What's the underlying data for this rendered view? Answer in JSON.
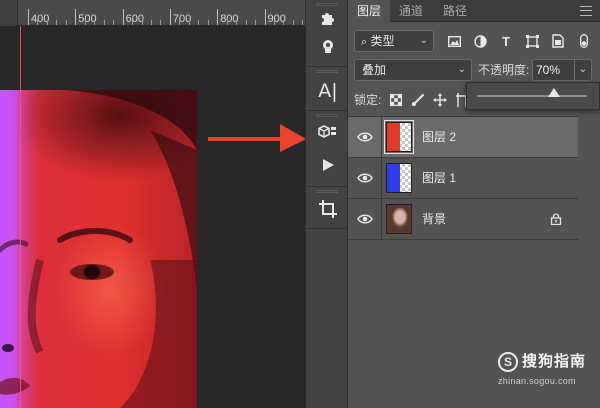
{
  "ruler": {
    "ticks": [
      "400",
      "500",
      "600",
      "700",
      "800",
      "900"
    ]
  },
  "panel": {
    "tabs": [
      {
        "label": "图层",
        "active": true
      },
      {
        "label": "通道",
        "active": false
      },
      {
        "label": "路径",
        "active": false
      }
    ],
    "filter": {
      "label": "类型",
      "icons": [
        "image-filter-icon",
        "adjustment-filter-icon",
        "type-filter-icon",
        "shape-filter-icon",
        "smart-object-filter-icon"
      ]
    },
    "blend_mode": "叠加",
    "opacity_label": "不透明度:",
    "opacity_value": "70%",
    "opacity_fraction": 0.7,
    "lock_label": "锁定:",
    "layers": [
      {
        "name": "图层 2",
        "selected": true,
        "thumb_color": "#e03a2a",
        "visible": true,
        "locked": false
      },
      {
        "name": "图层 1",
        "selected": false,
        "thumb_color": "#2f3fe8",
        "visible": true,
        "locked": false
      },
      {
        "name": "背景",
        "selected": false,
        "thumb_color": "#b07a6a",
        "visible": true,
        "locked": true
      }
    ]
  },
  "tools": {
    "text_tool_label": "A|"
  },
  "watermark": {
    "symbol": "S",
    "brand": "搜狗指南",
    "url": "zhinan.sogou.com"
  },
  "colors": {
    "pointer_arrow": "#e8442e",
    "guide_line": "#ff5a5a"
  }
}
